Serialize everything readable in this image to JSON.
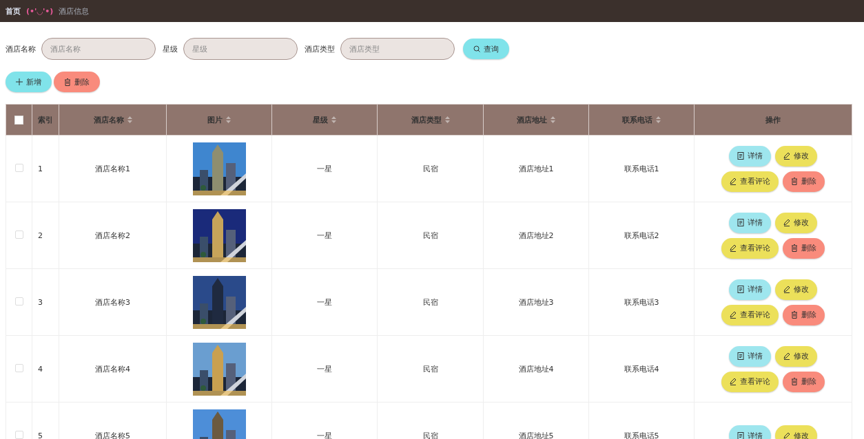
{
  "breadcrumb": {
    "home": "首页",
    "emoticon": "(•'◡'•)",
    "current": "酒店信息"
  },
  "filters": [
    {
      "label": "酒店名称",
      "placeholder": "酒店名称"
    },
    {
      "label": "星级",
      "placeholder": "星级"
    },
    {
      "label": "酒店类型",
      "placeholder": "酒店类型"
    }
  ],
  "search_button": "查询",
  "toolbar": [
    {
      "kind": "add",
      "label": "新增"
    },
    {
      "kind": "delete",
      "label": "删除"
    }
  ],
  "table": {
    "select_all": {
      "checked": false
    },
    "columns": [
      {
        "label": "索引",
        "sortable": false
      },
      {
        "label": "酒店名称",
        "sortable": true
      },
      {
        "label": "图片",
        "sortable": true
      },
      {
        "label": "星级",
        "sortable": true
      },
      {
        "label": "酒店类型",
        "sortable": true
      },
      {
        "label": "酒店地址",
        "sortable": true
      },
      {
        "label": "联系电话",
        "sortable": true
      },
      {
        "label": "操作",
        "sortable": false
      }
    ],
    "rows": [
      {
        "checked": false,
        "index": "1",
        "name": "酒店名称1",
        "picture": {
          "kind": "picture"
        },
        "stars": "一星",
        "type": "民宿",
        "address": "酒店地址1",
        "phone": "联系电话1",
        "actions": [
          {
            "kind": "detail",
            "label": "详情"
          },
          {
            "kind": "edit",
            "label": "修改"
          },
          {
            "kind": "review",
            "label": "查看评论"
          },
          {
            "kind": "delete",
            "label": "删除"
          }
        ]
      },
      {
        "checked": false,
        "index": "2",
        "name": "酒店名称2",
        "picture": {
          "kind": "picture"
        },
        "stars": "一星",
        "type": "民宿",
        "address": "酒店地址2",
        "phone": "联系电话2",
        "actions": [
          {
            "kind": "detail",
            "label": "详情"
          },
          {
            "kind": "edit",
            "label": "修改"
          },
          {
            "kind": "review",
            "label": "查看评论"
          },
          {
            "kind": "delete",
            "label": "删除"
          }
        ]
      },
      {
        "checked": false,
        "index": "3",
        "name": "酒店名称3",
        "picture": {
          "kind": "picture"
        },
        "stars": "一星",
        "type": "民宿",
        "address": "酒店地址3",
        "phone": "联系电话3",
        "actions": [
          {
            "kind": "detail",
            "label": "详情"
          },
          {
            "kind": "edit",
            "label": "修改"
          },
          {
            "kind": "review",
            "label": "查看评论"
          },
          {
            "kind": "delete",
            "label": "删除"
          }
        ]
      },
      {
        "checked": false,
        "index": "4",
        "name": "酒店名称4",
        "picture": {
          "kind": "picture"
        },
        "stars": "一星",
        "type": "民宿",
        "address": "酒店地址4",
        "phone": "联系电话4",
        "actions": [
          {
            "kind": "detail",
            "label": "详情"
          },
          {
            "kind": "edit",
            "label": "修改"
          },
          {
            "kind": "review",
            "label": "查看评论"
          },
          {
            "kind": "delete",
            "label": "删除"
          }
        ]
      },
      {
        "checked": false,
        "index": "5",
        "name": "酒店名称5",
        "picture": {
          "kind": "picture"
        },
        "stars": "一星",
        "type": "民宿",
        "address": "酒店地址5",
        "phone": "联系电话5",
        "actions": [
          {
            "kind": "detail",
            "label": "详情"
          },
          {
            "kind": "edit",
            "label": "修改"
          }
        ]
      }
    ]
  }
}
